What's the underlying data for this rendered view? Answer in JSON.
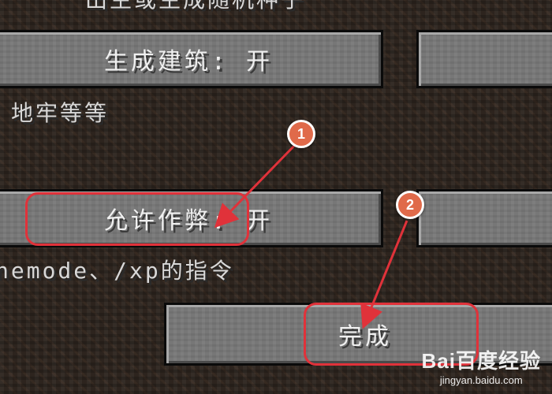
{
  "top_partial_text": "出生或生成随机种子",
  "buttons": {
    "generate_structures": "生成建筑: 开",
    "allow_cheats": "允许作弊: 开",
    "done": "完成",
    "right_top": "",
    "right_mid": ""
  },
  "descriptions": {
    "structures": "地牢等等",
    "cheats": "nemode、/xp的指令"
  },
  "annotations": {
    "marker_1": "1",
    "marker_2": "2",
    "highlight_color": "#e0323a",
    "marker_color": "#e06a4a"
  },
  "watermark": {
    "brand": "Bai百度经验",
    "url": "jingyan.baidu.com"
  }
}
